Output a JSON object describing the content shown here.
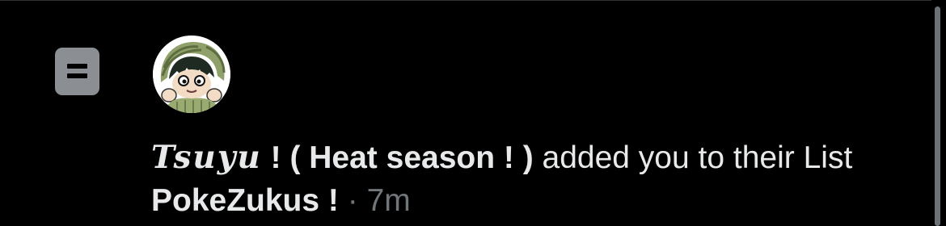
{
  "notification": {
    "icon": "list-icon",
    "avatar": "user-avatar-anime-character",
    "user_display_name_styled": "Tsuyu",
    "user_display_name_rest": " ! ( Heat season ! )",
    "action_text": " added you to their ",
    "list_word": "List",
    "list_name": "PokeZukus !",
    "separator": " · ",
    "timestamp": "7m"
  },
  "colors": {
    "background": "#000000",
    "primary_text": "#e7e9ea",
    "secondary_text": "#71767b",
    "icon_bg": "#8b8f94"
  }
}
